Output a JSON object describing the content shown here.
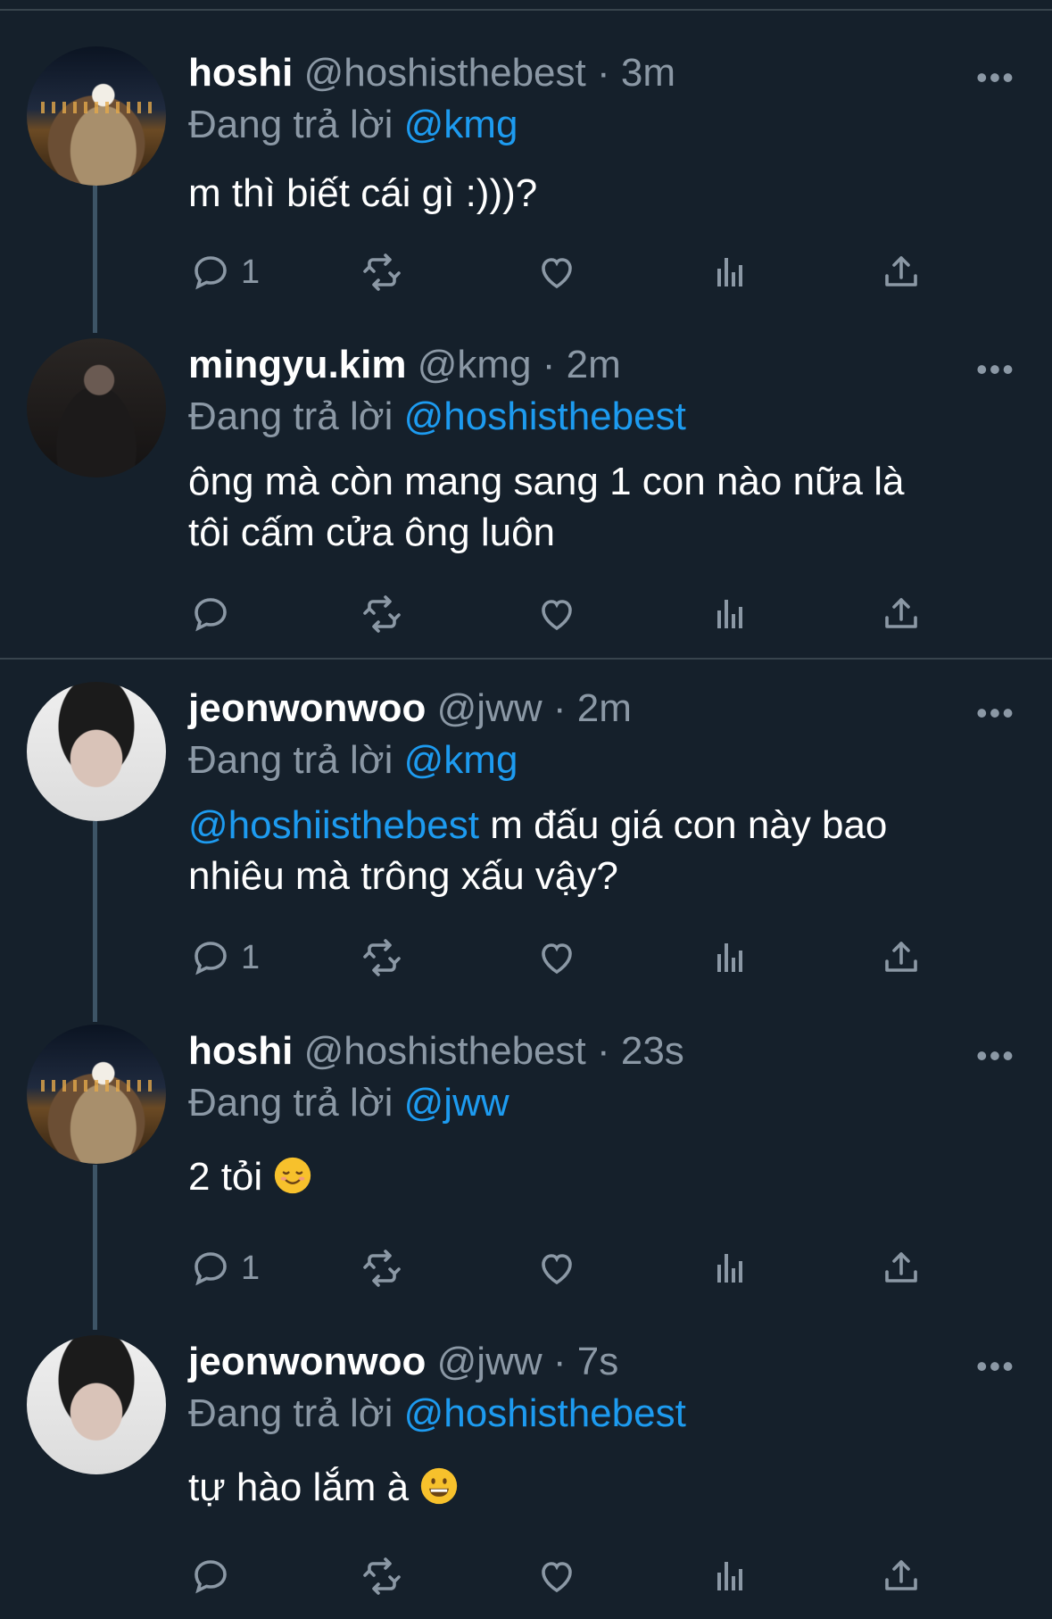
{
  "reply_prefix": "Đang trả lời",
  "tweets": [
    {
      "name": "hoshi",
      "handle": "@hoshisthebest",
      "time": "· 3m",
      "reply_to": "@kmg",
      "text": "m thì biết cái gì :)))?",
      "reply_count": "1"
    },
    {
      "name": "mingyu.kim",
      "handle": "@kmg",
      "time": "· 2m",
      "reply_to": "@hoshisthebest",
      "text_line1": "ông mà còn mang sang 1 con nào nữa là",
      "text_line2": "tôi cấm cửa ông luôn",
      "reply_count": ""
    },
    {
      "name": "jeonwonwoo",
      "handle": "@jww",
      "time": "· 2m",
      "reply_to": "@kmg",
      "text_mention": "@hoshiisthebest",
      "text_line1_rest": " m đấu giá con này bao",
      "text_line2": "nhiêu mà trông xấu vậy?",
      "reply_count": "1"
    },
    {
      "name": "hoshi",
      "handle": "@hoshisthebest",
      "time": "· 23s",
      "reply_to": "@jww",
      "text": "2 tỏi",
      "emoji": "smiling-face-emoji",
      "reply_count": "1"
    },
    {
      "name": "jeonwonwoo",
      "handle": "@jww",
      "time": "· 7s",
      "reply_to": "@hoshisthebest",
      "text": "tự hào lắm à",
      "emoji": "grinning-face-emoji",
      "reply_count": ""
    }
  ],
  "more_label": "•••",
  "colors": {
    "background": "#15202b",
    "muted": "#8b98a5",
    "accent": "#1d9bf0",
    "divider": "#38444d"
  }
}
